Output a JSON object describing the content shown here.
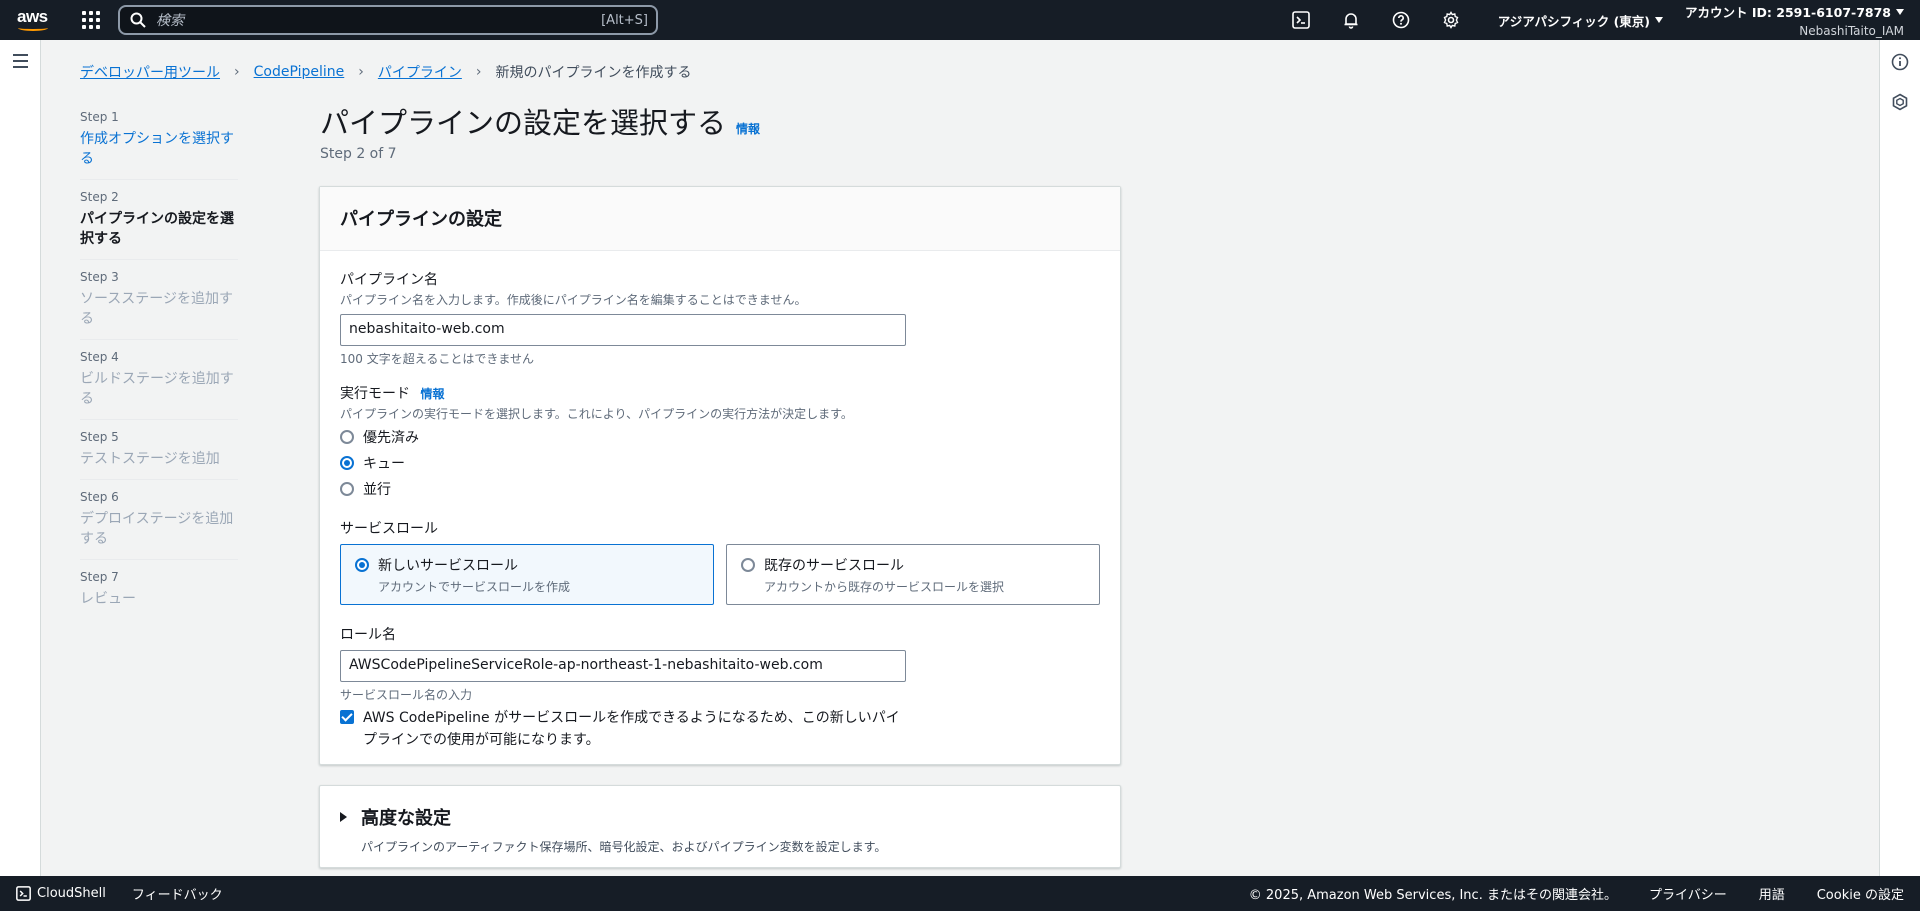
{
  "topnav": {
    "logo": "aws",
    "search_placeholder": "検索",
    "search_shortcut": "[Alt+S]",
    "region": "アジアパシフィック (東京)",
    "account": "アカウント ID: 2591-6107-7878",
    "user": "NebashiTaito_IAM",
    "icons": [
      "cloudshell-icon",
      "bell-icon",
      "help-icon",
      "gear-icon"
    ]
  },
  "breadcrumb": {
    "items": [
      "デベロッパー用ツール",
      "CodePipeline",
      "パイプライン"
    ],
    "current": "新規のパイプラインを作成する"
  },
  "steps": [
    {
      "num": "Step 1",
      "label": "作成オプションを選択する",
      "state": "link"
    },
    {
      "num": "Step 2",
      "label": "パイプラインの設定を選択する",
      "state": "active"
    },
    {
      "num": "Step 3",
      "label": "ソースステージを追加する",
      "state": "disabled"
    },
    {
      "num": "Step 4",
      "label": "ビルドステージを追加する",
      "state": "disabled"
    },
    {
      "num": "Step 5",
      "label": "テストステージを追加",
      "state": "disabled"
    },
    {
      "num": "Step 6",
      "label": "デプロイステージを追加する",
      "state": "disabled"
    },
    {
      "num": "Step 7",
      "label": "レビュー",
      "state": "disabled"
    }
  ],
  "page": {
    "title": "パイプラインの設定を選択する",
    "info": "情報",
    "step_of": "Step 2 of 7"
  },
  "settings": {
    "header": "パイプラインの設定",
    "name_label": "パイプライン名",
    "name_desc": "パイプライン名を入力します。作成後にパイプライン名を編集することはできません。",
    "name_value": "nebashitaito-web.com",
    "name_constraint": "100 文字を超えることはできません",
    "mode_label": "実行モード",
    "mode_info": "情報",
    "mode_desc": "パイプラインの実行モードを選択します。これにより、パイプラインの実行方法が決定します。",
    "mode_options": [
      "優先済み",
      "キュー",
      "並行"
    ],
    "mode_selected": "キュー",
    "role_label": "サービスロール",
    "role_tiles": [
      {
        "title": "新しいサービスロール",
        "desc": "アカウントでサービスロールを作成",
        "selected": true
      },
      {
        "title": "既存のサービスロール",
        "desc": "アカウントから既存のサービスロールを選択",
        "selected": false
      }
    ],
    "role_name_label": "ロール名",
    "role_name_value": "AWSCodePipelineServiceRole-ap-northeast-1-nebashitaito-web.com",
    "role_name_hint": "サービスロール名の入力",
    "checkbox_text": "AWS CodePipeline がサービスロールを作成できるようになるため、この新しいパイプラインでの使用が可能になります。",
    "checkbox_checked": true
  },
  "advanced": {
    "title": "高度な設定",
    "desc": "パイプラインのアーティファクト保存場所、暗号化設定、およびパイプライン変数を設定します。"
  },
  "footer": {
    "cloudshell": "CloudShell",
    "feedback": "フィードバック",
    "copyright": "© 2025, Amazon Web Services, Inc. またはその関連会社。",
    "privacy": "プライバシー",
    "terms": "用語",
    "cookie": "Cookie の設定"
  }
}
